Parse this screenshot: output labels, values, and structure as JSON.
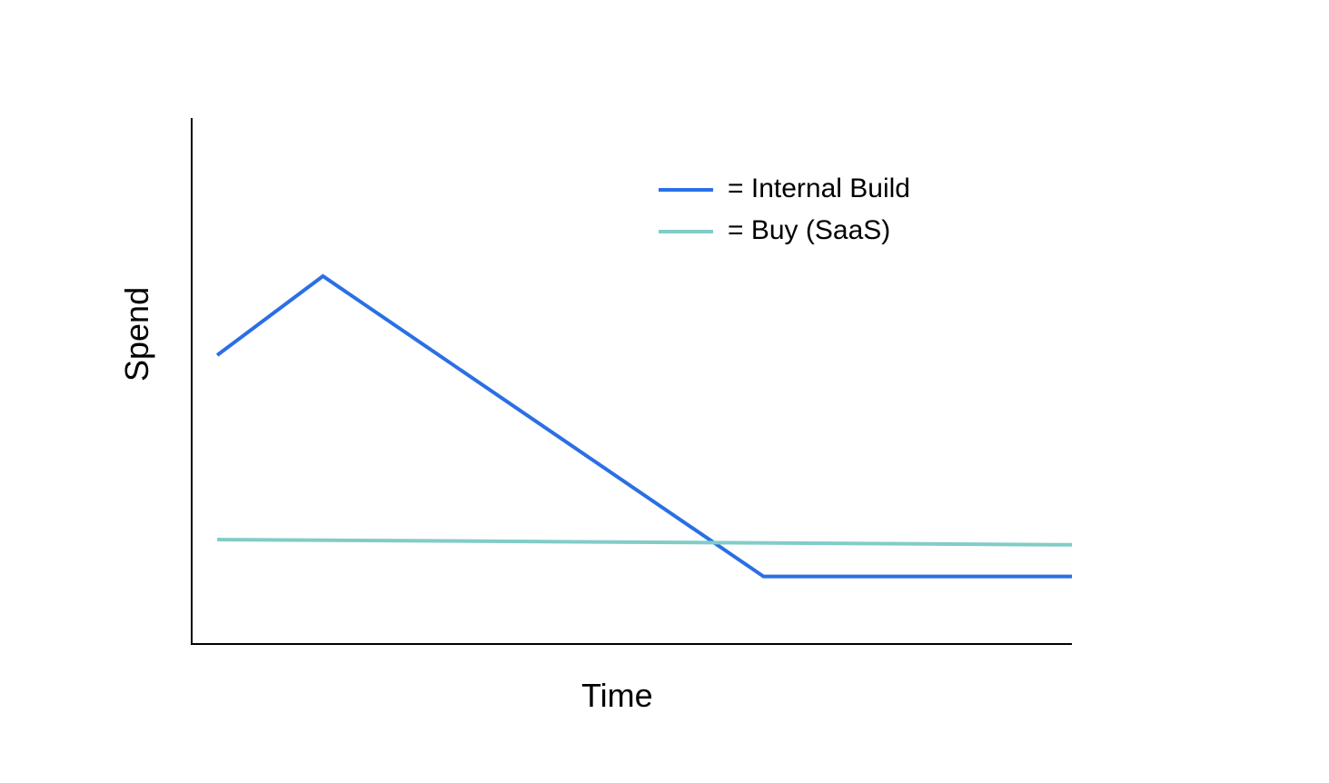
{
  "chart_data": {
    "type": "line",
    "xlabel": "Time",
    "ylabel": "Spend",
    "xlim": [
      0,
      100
    ],
    "ylim": [
      0,
      100
    ],
    "series": [
      {
        "name": "Internal Build",
        "color": "#2B6FE5",
        "x": [
          3,
          15,
          65,
          100
        ],
        "y": [
          55,
          70,
          13,
          13
        ]
      },
      {
        "name": "Buy (SaaS)",
        "color": "#82CCC8",
        "x": [
          3,
          100
        ],
        "y": [
          20,
          19
        ]
      }
    ],
    "legend": {
      "items": [
        {
          "label": "= Internal Build",
          "color": "#2B6FE5"
        },
        {
          "label": "= Buy (SaaS)",
          "color": "#82CCC8"
        }
      ]
    }
  }
}
